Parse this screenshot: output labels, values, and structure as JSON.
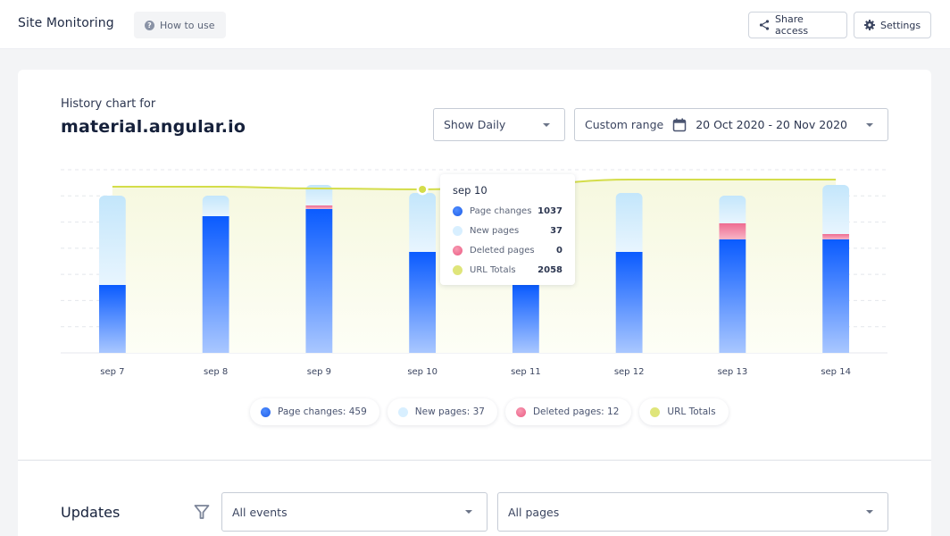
{
  "header": {
    "app_title": "Site Monitoring",
    "how_to_use": "How to use",
    "share_access": "Share access",
    "settings": "Settings"
  },
  "history": {
    "label": "History chart for",
    "site": "material.angular.io",
    "interval_select": "Show Daily",
    "range_label": "Custom range",
    "range_value": "20 Oct 2020 - 20 Nov 2020"
  },
  "tooltip": {
    "title": "sep 10",
    "rows": [
      {
        "label": "Page changes",
        "value": "1037"
      },
      {
        "label": "New pages",
        "value": "37"
      },
      {
        "label": "Deleted pages",
        "value": "0"
      },
      {
        "label": "URL Totals",
        "value": "2058"
      }
    ]
  },
  "legend": [
    {
      "label": "Page changes: 459"
    },
    {
      "label": "New pages: 37"
    },
    {
      "label": "Deleted pages: 12"
    },
    {
      "label": "URL Totals"
    }
  ],
  "colors": {
    "page_changes": "#1f5ee8",
    "new_pages": "#c6e8fb",
    "deleted_pages": "#ef6f92",
    "url_totals": "#d4dd4a",
    "area_fill": "#f8fae6"
  },
  "chart_data": {
    "type": "bar",
    "stacked": true,
    "title": "History chart for material.angular.io",
    "xlabel": "",
    "ylabel": "",
    "categories": [
      "sep 7",
      "sep 8",
      "sep 9",
      "sep 10",
      "sep 11",
      "sep 12",
      "sep 13",
      "sep 14"
    ],
    "ylim": [
      0,
      2800
    ],
    "grid": true,
    "legend_position": "bottom",
    "series": [
      {
        "name": "Page changes",
        "kind": "bar",
        "values": [
          1038,
          2090,
          2199,
          1544,
          1038,
          1544,
          1735,
          1735
        ]
      },
      {
        "name": "Deleted pages",
        "kind": "bar",
        "values": [
          0,
          0,
          55,
          0,
          178,
          0,
          246,
          82
        ]
      },
      {
        "name": "New pages",
        "kind": "bar",
        "values": [
          1366,
          314,
          314,
          902,
          287,
          902,
          423,
          751
        ]
      },
      {
        "name": "URL Totals",
        "kind": "area-line",
        "values": [
          2541,
          2541,
          2513,
          2500,
          2582,
          2650,
          2650,
          2650
        ]
      }
    ],
    "highlighted_category": "sep 10"
  },
  "updates": {
    "title": "Updates",
    "events_select": "All events",
    "pages_select": "All pages"
  }
}
